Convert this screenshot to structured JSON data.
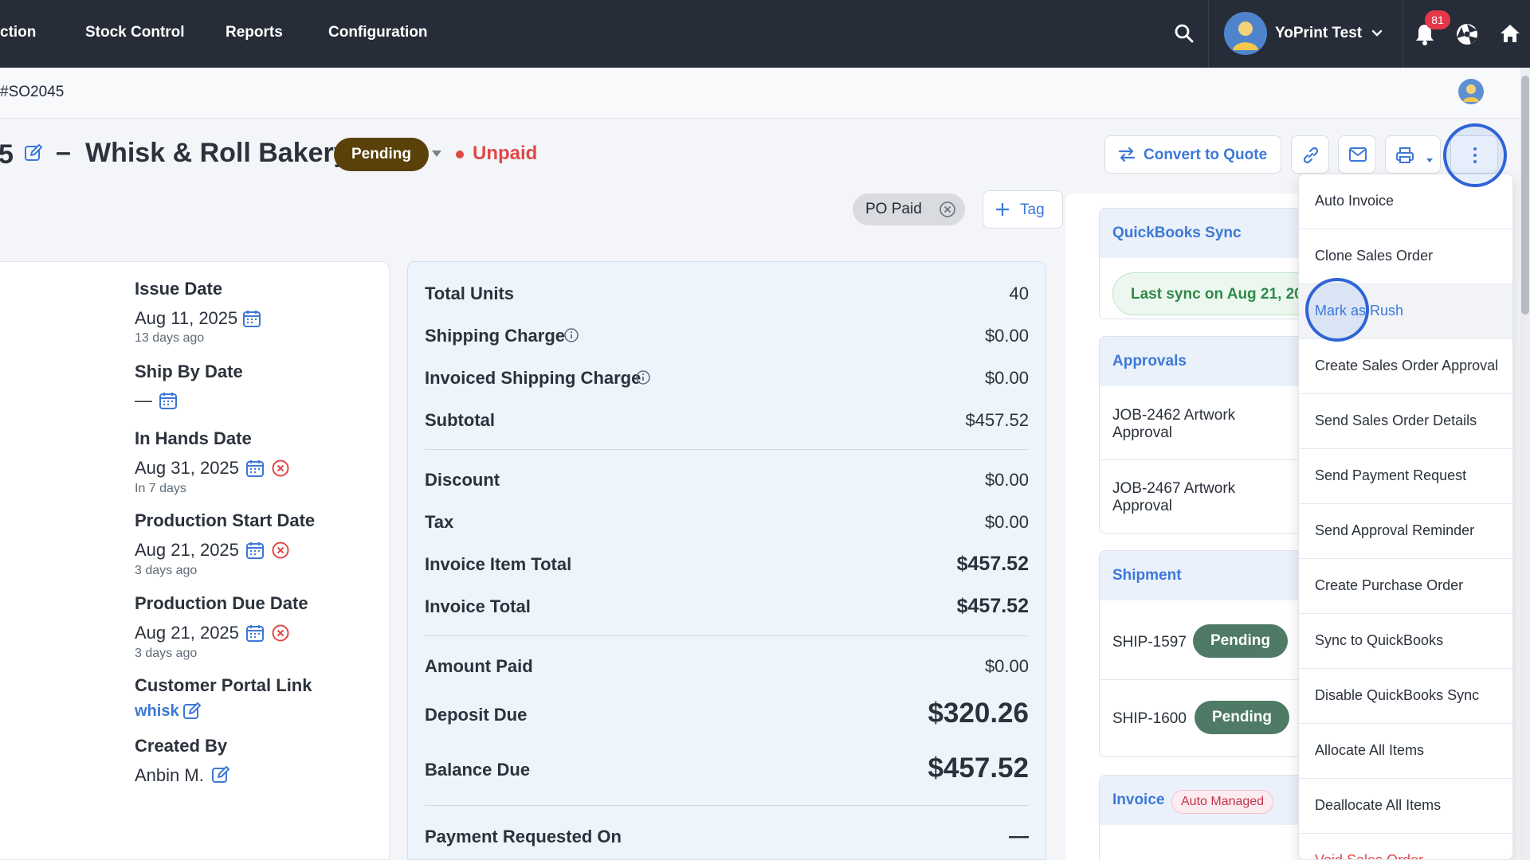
{
  "nav": {
    "items": [
      "ction",
      "Stock Control",
      "Reports",
      "Configuration"
    ],
    "user_name": "YoPrint Test",
    "notification_count": "81",
    "icons": [
      "search-icon",
      "user-avatar",
      "chevron-down-icon",
      "bell-icon",
      "aperture-icon",
      "home-icon"
    ]
  },
  "breadcrumb": {
    "text": "#SO2045"
  },
  "header": {
    "order_number": "5",
    "separator": "–",
    "customer": "Whisk & Roll Bakery",
    "status": "Pending",
    "payment_status": "Unpaid",
    "convert_button": "Convert to Quote",
    "tag_chip": "PO Paid",
    "tag_button": "Tag"
  },
  "dates": {
    "issue_label": "Issue Date",
    "issue_value": "Aug 11, 2025",
    "issue_sub": "13 days ago",
    "ship_label": "Ship By Date",
    "ship_value": "—",
    "inhands_label": "In Hands Date",
    "inhands_value": "Aug 31, 2025",
    "inhands_sub": "In 7 days",
    "prodstart_label": "Production Start Date",
    "prodstart_value": "Aug 21, 2025",
    "prodstart_sub": "3 days ago",
    "proddue_label": "Production Due Date",
    "proddue_value": "Aug 21, 2025",
    "proddue_sub": "3 days ago",
    "portal_label": "Customer Portal Link",
    "portal_value": "whisk",
    "createdby_label": "Created By",
    "createdby_value": "Anbin M."
  },
  "totals": [
    {
      "label": "Total Units",
      "value": "40"
    },
    {
      "label": "Shipping Charge",
      "value": "$0.00"
    },
    {
      "label": "Invoiced Shipping Charge",
      "value": "$0.00"
    },
    {
      "label": "Subtotal",
      "value": "$457.52"
    },
    {
      "label": "Discount",
      "value": "$0.00"
    },
    {
      "label": "Tax",
      "value": "$0.00"
    },
    {
      "label": "Invoice Item Total",
      "value": "$457.52"
    },
    {
      "label": "Invoice Total",
      "value": "$457.52"
    },
    {
      "label": "Amount Paid",
      "value": "$0.00"
    },
    {
      "label": "Deposit Due",
      "value": "$320.26"
    },
    {
      "label": "Balance Due",
      "value": "$457.52"
    },
    {
      "label": "Payment Requested On",
      "value": "—"
    }
  ],
  "side": {
    "quickbooks_title": "QuickBooks Sync",
    "quickbooks_sync": "Last sync on Aug 21, 20",
    "approvals_title": "Approvals",
    "approvals": [
      "JOB-2462 Artwork Approval",
      "JOB-2467 Artwork Approval"
    ],
    "shipment_title": "Shipment",
    "shipments": [
      {
        "id": "SHIP-1597",
        "status": "Pending"
      },
      {
        "id": "SHIP-1600",
        "status": "Pending"
      }
    ],
    "invoice_title": "Invoice",
    "invoice_badge": "Auto Managed"
  },
  "menu": {
    "items": [
      "Auto Invoice",
      "Clone Sales Order",
      "Mark as Rush",
      "Create Sales Order Approval",
      "Send Sales Order Details",
      "Send Payment Request",
      "Send Approval Reminder",
      "Create Purchase Order",
      "Sync to QuickBooks",
      "Disable QuickBooks Sync",
      "Allocate All Items",
      "Deallocate All Items",
      "Void Sales Order"
    ],
    "hovered": "Mark as Rush"
  },
  "colors": {
    "nav_bg": "#272d38",
    "accent": "#3d78d6",
    "pending_pill": "#5a4009",
    "unpaid": "#e04848",
    "shipment_pill": "#4f7a66"
  }
}
